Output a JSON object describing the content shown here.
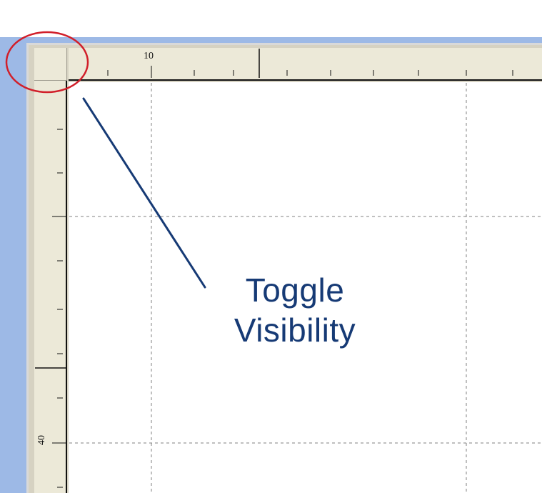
{
  "ruler": {
    "top_labels": [
      {
        "text": "10"
      }
    ],
    "left_labels": [
      {
        "text": "40"
      }
    ]
  },
  "annotation": {
    "lines": [
      "Toggle",
      "Visibility"
    ]
  },
  "colors": {
    "window_frame": "#9db9e6",
    "ruler_fill": "#ece9d8",
    "ruler_border": "#111111",
    "guide_line": "#808080",
    "callout_circle": "#d11f2a",
    "annotation_text": "#163a75"
  },
  "icons": {
    "corner_target": "ruler-corner-toggle"
  }
}
